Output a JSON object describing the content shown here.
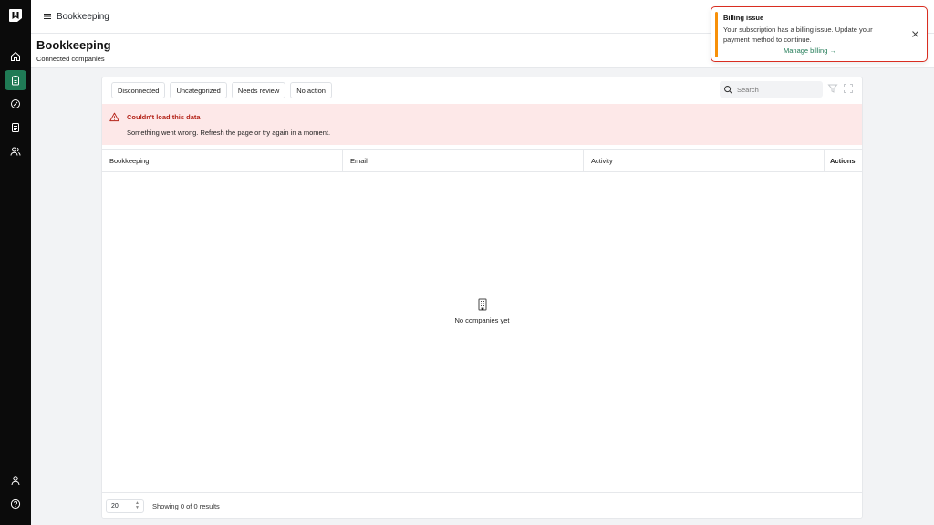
{
  "topbar": {
    "title": "Bookkeeping"
  },
  "page": {
    "title": "Bookkeeping",
    "subtitle": "Connected companies"
  },
  "filters": [
    {
      "label": "Disconnected"
    },
    {
      "label": "Uncategorized"
    },
    {
      "label": "Needs review"
    },
    {
      "label": "No action"
    }
  ],
  "search": {
    "placeholder": "Search"
  },
  "error": {
    "title": "Couldn't load this data",
    "message": "Something went wrong. Refresh the page or try again in a moment."
  },
  "table": {
    "columns": [
      "Bookkeeping",
      "Email",
      "Activity",
      "Actions"
    ]
  },
  "empty_state": {
    "text": "No companies yet"
  },
  "pagination": {
    "page_size": "20",
    "results_text": "Showing 0 of 0 results"
  },
  "toast": {
    "title": "Billing issue",
    "message": "Your subscription has a billing issue. Update your payment method to continue.",
    "link": "Manage billing →"
  },
  "colors": {
    "accent": "#1f7a55",
    "error_bg": "#fde8e8",
    "error_text": "#b42318",
    "toast_border": "#d92d20",
    "toast_bar": "#f79009"
  }
}
